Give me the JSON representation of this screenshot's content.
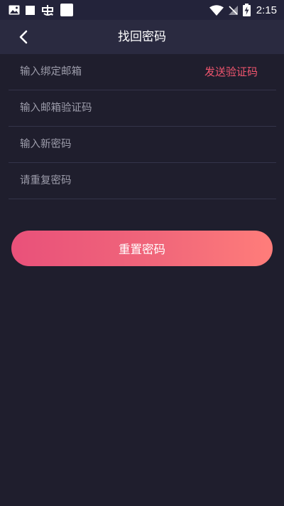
{
  "status_bar": {
    "time": "2:15",
    "left_icons": [
      "image-icon",
      "square-notification-icon",
      "bug-icon",
      "app-notification-icon"
    ],
    "right_icons": [
      "wifi-icon",
      "no-sim-icon",
      "battery-charging-icon"
    ]
  },
  "header": {
    "title": "找回密码",
    "back_icon": "chevron-left-icon"
  },
  "form": {
    "email_placeholder": "输入绑定邮箱",
    "send_code_label": "发送验证码",
    "code_placeholder": "输入邮箱验证码",
    "new_password_placeholder": "输入新密码",
    "repeat_password_placeholder": "请重复密码"
  },
  "actions": {
    "reset_label": "重置密码"
  },
  "colors": {
    "background": "#1f1e2d",
    "header": "#2a2a40",
    "accent": "#f0556e",
    "button_gradient_start": "#e9517a",
    "button_gradient_end": "#ff7d7a",
    "placeholder": "#9c9caa",
    "divider": "#34344a"
  }
}
